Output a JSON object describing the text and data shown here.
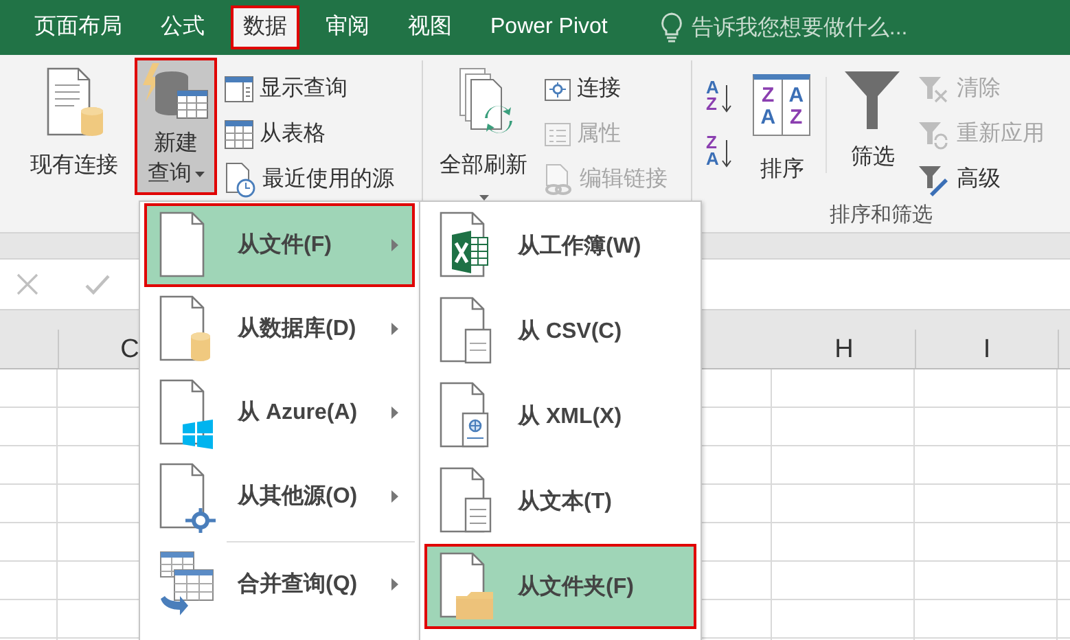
{
  "tabs": [
    {
      "label": "页面布局",
      "selected": false,
      "annotated": false
    },
    {
      "label": "公式",
      "selected": false,
      "annotated": false
    },
    {
      "label": "数据",
      "selected": true,
      "annotated": true
    },
    {
      "label": "审阅",
      "selected": false,
      "annotated": false
    },
    {
      "label": "视图",
      "selected": false,
      "annotated": false
    },
    {
      "label": "Power Pivot",
      "selected": false,
      "annotated": false
    }
  ],
  "tell_me": {
    "text": "告诉我您想要做什么..."
  },
  "ribbon": {
    "existing_connections": {
      "label": "现有连接"
    },
    "new_query": {
      "label_lines": [
        "新建",
        "查询"
      ],
      "pressed": true,
      "annotated": true
    },
    "query_commands": [
      {
        "label": "显示查询",
        "disabled": false
      },
      {
        "label": "从表格",
        "disabled": false
      },
      {
        "label": "最近使用的源",
        "disabled": false
      }
    ],
    "refresh_all": {
      "label": "全部刷新"
    },
    "connection_commands": [
      {
        "label": "连接",
        "disabled": false
      },
      {
        "label": "属性",
        "disabled": true
      },
      {
        "label": "编辑链接",
        "disabled": true
      }
    ],
    "sort_filter": {
      "group_label": "排序和筛选",
      "sort_ascending_letters": [
        "A",
        "Z"
      ],
      "sort_descending_letters": [
        "Z",
        "A"
      ],
      "sort_dialog_letters": [
        [
          "Z",
          "A"
        ],
        [
          "A",
          "Z"
        ]
      ],
      "sort": {
        "label": "排序"
      },
      "filter": {
        "label": "筛选"
      },
      "filter_commands": [
        {
          "label": "清除",
          "disabled": true
        },
        {
          "label": "重新应用",
          "disabled": true
        },
        {
          "label": "高级",
          "disabled": false
        }
      ]
    }
  },
  "sheet": {
    "columns": [
      {
        "header": "C"
      },
      {
        "header": "H"
      },
      {
        "header": "I"
      }
    ]
  },
  "menu": {
    "items": [
      {
        "label": "从文件(F)",
        "selected": true,
        "annotated": true,
        "group_start": false
      },
      {
        "label": "从数据库(D)",
        "selected": false,
        "annotated": false,
        "group_start": false
      },
      {
        "label": "从 Azure(A)",
        "selected": false,
        "annotated": false,
        "group_start": false
      },
      {
        "label": "从其他源(O)",
        "selected": false,
        "annotated": false,
        "group_start": false
      },
      {
        "label": "合并查询(Q)",
        "selected": false,
        "annotated": false,
        "group_start": true
      }
    ]
  },
  "submenu": {
    "items": [
      {
        "label": "从工作簿(W)",
        "selected": false,
        "annotated": false
      },
      {
        "label": "从 CSV(C)",
        "selected": false,
        "annotated": false
      },
      {
        "label": "从 XML(X)",
        "selected": false,
        "annotated": false
      },
      {
        "label": "从文本(T)",
        "selected": false,
        "annotated": false
      },
      {
        "label": "从文件夹(F)",
        "selected": true,
        "annotated": true
      }
    ]
  }
}
